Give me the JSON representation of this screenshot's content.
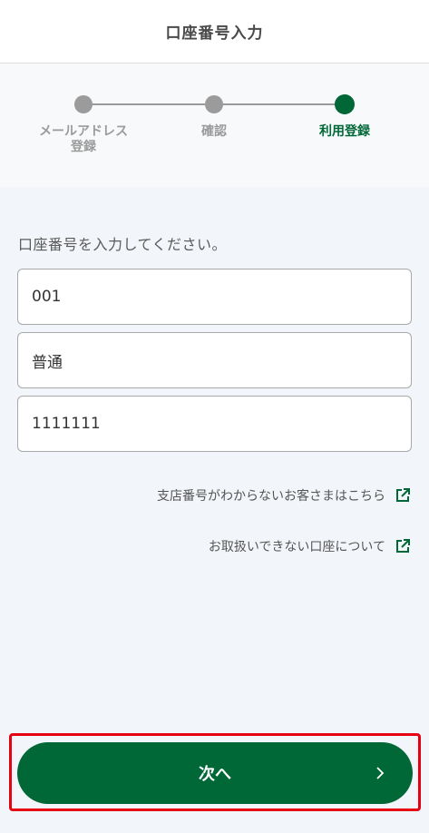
{
  "header": {
    "title": "口座番号入力"
  },
  "stepper": {
    "steps": [
      {
        "label": "メールアドレス\n登録",
        "state": "done"
      },
      {
        "label": "確認",
        "state": "done"
      },
      {
        "label": "利用登録",
        "state": "current"
      }
    ]
  },
  "form": {
    "instruction": "口座番号を入力してください。",
    "branch_code": "001",
    "account_type": "普通",
    "account_number": "1111111"
  },
  "links": [
    {
      "label": "支店番号がわからないお客さまはこちら",
      "icon": "external-link-icon"
    },
    {
      "label": "お取扱いできない口座について",
      "icon": "external-link-icon"
    }
  ],
  "footer": {
    "next_label": "次へ",
    "icon": "chevron-right-icon"
  },
  "colors": {
    "accent": "#006837",
    "inactive": "#9b9b9b",
    "highlight_frame": "#e60012"
  }
}
